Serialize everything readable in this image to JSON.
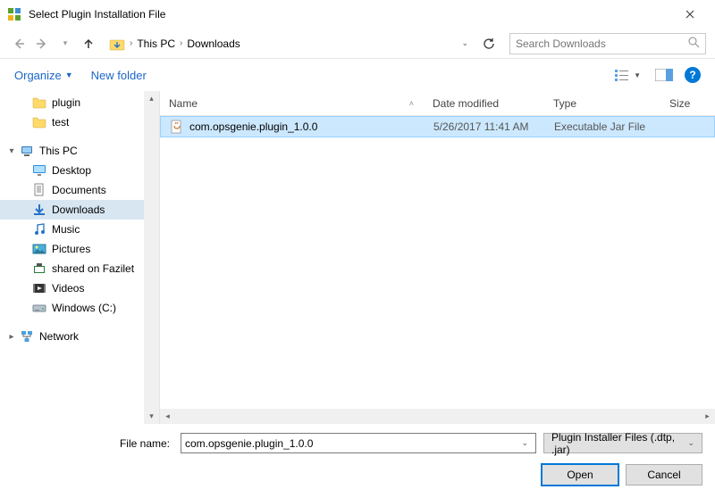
{
  "window": {
    "title": "Select Plugin Installation File"
  },
  "nav": {
    "breadcrumb": {
      "root": "This PC",
      "folder": "Downloads"
    },
    "search_placeholder": "Search Downloads"
  },
  "toolbar": {
    "organize": "Organize",
    "new_folder": "New folder"
  },
  "tree": {
    "items": [
      {
        "label": "plugin",
        "icon": "folder",
        "level": 1
      },
      {
        "label": "test",
        "icon": "folder",
        "level": 1
      },
      {
        "label": "This PC",
        "icon": "pc",
        "level": 0,
        "expandable": true
      },
      {
        "label": "Desktop",
        "icon": "desktop",
        "level": 1
      },
      {
        "label": "Documents",
        "icon": "documents",
        "level": 1
      },
      {
        "label": "Downloads",
        "icon": "downloads",
        "level": 1,
        "selected": true
      },
      {
        "label": "Music",
        "icon": "music",
        "level": 1
      },
      {
        "label": "Pictures",
        "icon": "pictures",
        "level": 1
      },
      {
        "label": "shared on Fazilet",
        "icon": "share",
        "level": 1
      },
      {
        "label": "Videos",
        "icon": "videos",
        "level": 1
      },
      {
        "label": "Windows (C:)",
        "icon": "disk",
        "level": 1
      },
      {
        "label": "Network",
        "icon": "network",
        "level": 0,
        "expandable": true
      }
    ]
  },
  "columns": {
    "name": "Name",
    "date": "Date modified",
    "type": "Type",
    "size": "Size"
  },
  "files": [
    {
      "name": "com.opsgenie.plugin_1.0.0",
      "date": "5/26/2017 11:41 AM",
      "type": "Executable Jar File",
      "size": "",
      "selected": true
    }
  ],
  "footer": {
    "filename_label": "File name:",
    "filename_value": "com.opsgenie.plugin_1.0.0",
    "filter": "Plugin Installer Files (.dtp, .jar)",
    "open": "Open",
    "cancel": "Cancel"
  }
}
